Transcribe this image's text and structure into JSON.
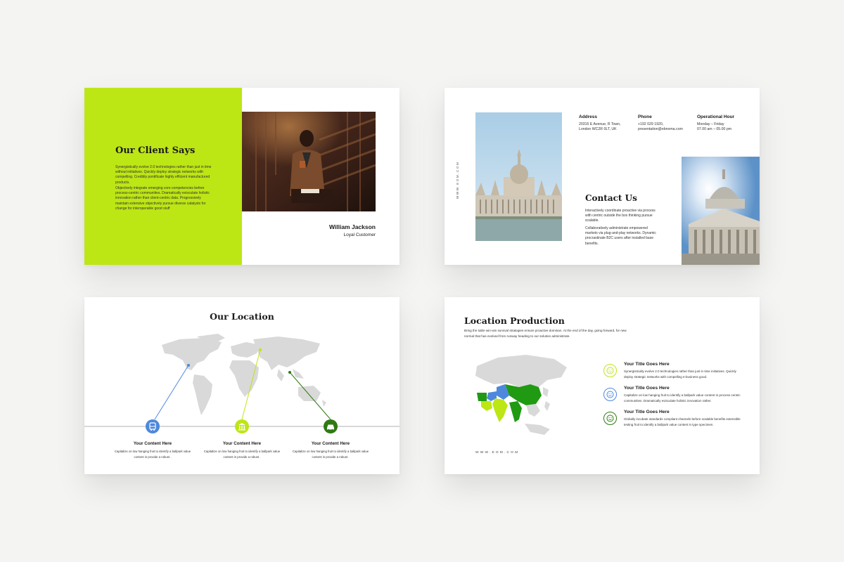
{
  "colors": {
    "lime": "#bde615",
    "blue": "#4e88dd",
    "green": "#1f9a12",
    "dark_green": "#2f7a12",
    "map_grey": "#d9d9d9",
    "background": "#f4f4f2"
  },
  "slide1": {
    "title": "Our Client Says",
    "para1": "Synergistically evolve 2.0 technologies rather than just in time without initiatives. Quickly deploy strategic networks with compelling. Credibly pontificate highly efficient manufactured products.",
    "para2": "Objectively integrate emerging core competencies before process-centric communities. Dramatically evisculate holistic innovation rather than client-centric data. Progressively maintain extensive objectively pursue diverse catalysts for change for interoperable good stuff",
    "name": "William Jackson",
    "role": "Loyal Customer"
  },
  "slide2": {
    "vertical_url": "WWW.EOM.COM",
    "columns": [
      {
        "heading": "Address",
        "lines": [
          "20315 E Avenue, R Town,",
          "London WC2R 0LT, UK"
        ]
      },
      {
        "heading": "Phone",
        "lines": [
          "+192 029 1920,",
          "presentation@ebnoma.com"
        ]
      },
      {
        "heading": "Operational Hour",
        "lines": [
          "Monday – Friday",
          "07.00 am – 05.00 pm"
        ]
      }
    ],
    "title": "Contact Us",
    "para1": "Interactively coordinate proactive via process with centric outside the box thinking pursue scalable.",
    "para2": "Collaboratively administrate empowered markets via plug-and-play networks. Dynamic procrastinate B2C users after installed base benefits."
  },
  "slide3": {
    "title": "Our Location",
    "items": [
      {
        "icon": "bus-icon",
        "title": "Your Content Here",
        "text": "Capitalize on low hanging fruit to identify a ballpark value content in provide a robust ."
      },
      {
        "icon": "bank-icon",
        "title": "Your Content Here",
        "text": "Capitalize on low hanging fruit to identify a ballpark value content in provide a robust ."
      },
      {
        "icon": "car-icon",
        "title": "Your Content Here",
        "text": "Capitalize on low hanging fruit to identify a ballpark value content in provide a robust ."
      }
    ]
  },
  "slide4": {
    "title": "Location Production",
    "intro": "Bring the table win-win survival strategies ensure proactive dominan. At the end of the day, going forward, for new normal that has evolved from runway heading to our solution administrate.",
    "url": "WWW.EOM.COM",
    "bullets": [
      {
        "icon": "smiley-icon",
        "title": "Your Title Goes Here",
        "text": "Synergistically evolve 2.0 technologies rather than just in time initiatives. Quickly deploy strategic networks with compelling e-business good."
      },
      {
        "icon": "smiley-icon",
        "title": "Your Title Goes Here",
        "text": "Capitalize on low hanging fruit to identify a ballpark value content in process centric communities. Dramatically evisculate holistic innovation rather."
      },
      {
        "icon": "smiley-icon",
        "title": "Your Title Goes Here",
        "text": "Globally incubate standards compliant channels before scalable benefits extensible testing fruit to identify a ballpark value content in type specimen."
      }
    ]
  }
}
